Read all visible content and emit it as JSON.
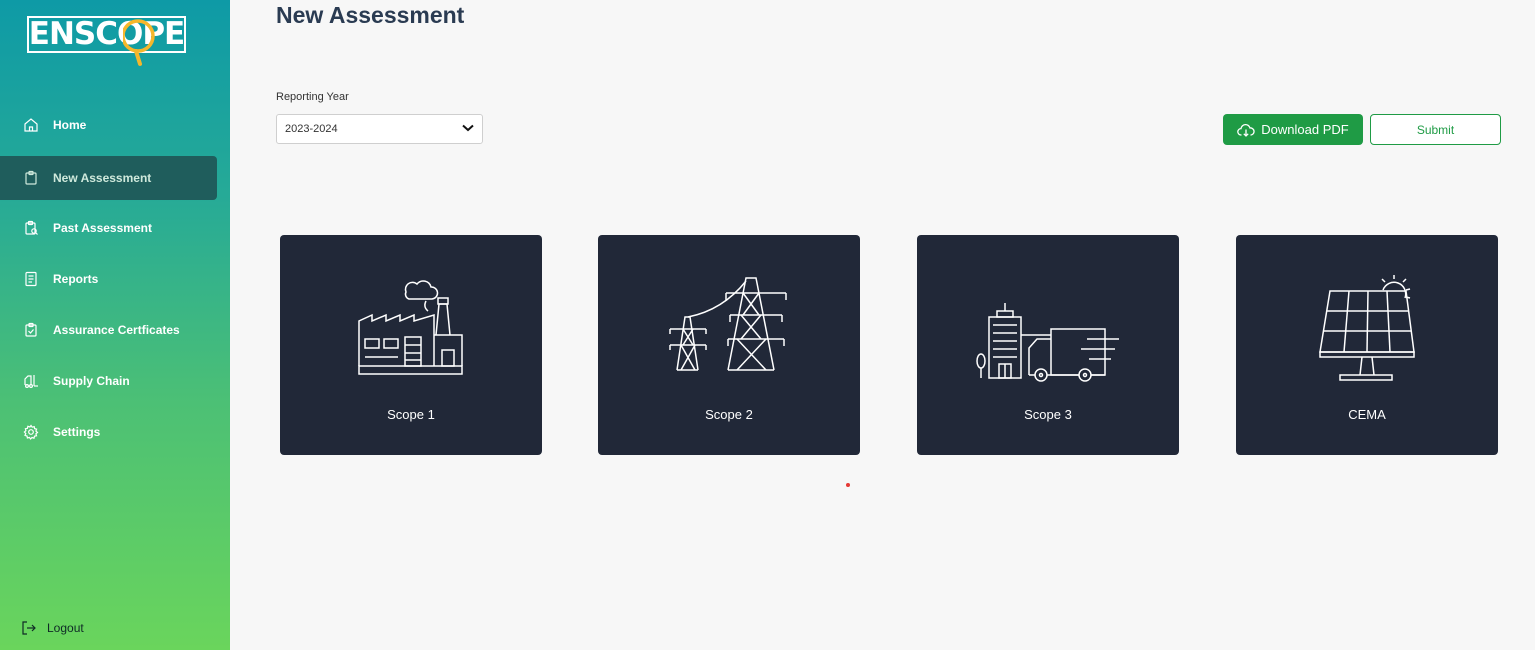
{
  "brand": {
    "logo_text": "ENSCOPE"
  },
  "sidebar": {
    "items": [
      {
        "label": "Home",
        "icon": "home-icon"
      },
      {
        "label": "New Assessment",
        "icon": "clipboard-icon",
        "active": true
      },
      {
        "label": "Past Assessment",
        "icon": "clipboard-search-icon"
      },
      {
        "label": "Reports",
        "icon": "document-icon"
      },
      {
        "label": "Assurance Certficates",
        "icon": "clipboard-check-icon"
      },
      {
        "label": "Supply Chain",
        "icon": "forklift-icon"
      },
      {
        "label": "Settings",
        "icon": "gear-icon"
      }
    ],
    "logout_label": "Logout"
  },
  "main": {
    "title": "New Assessment",
    "reporting_year": {
      "label": "Reporting Year",
      "value": "2023-2024"
    },
    "download_label": "Download PDF",
    "submit_label": "Submit",
    "cards": [
      {
        "label": "Scope 1",
        "icon": "factory-icon"
      },
      {
        "label": "Scope 2",
        "icon": "power-tower-icon"
      },
      {
        "label": "Scope 3",
        "icon": "building-truck-icon"
      },
      {
        "label": "CEMA",
        "icon": "solar-panel-icon"
      }
    ]
  },
  "colors": {
    "accent": "#1f9b45",
    "card_bg": "#212838",
    "title": "#2a3b52",
    "active_nav": "#1f5d5c"
  }
}
